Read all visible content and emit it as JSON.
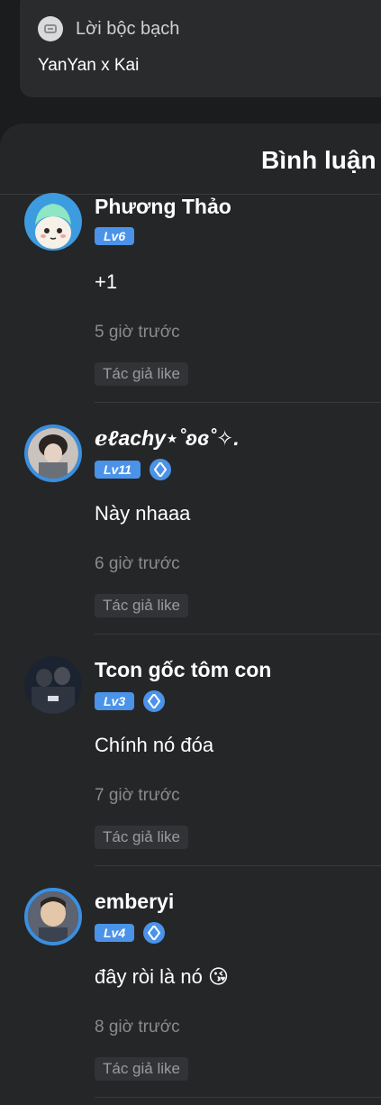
{
  "top": {
    "tag_label": "Lời bộc bạch",
    "story_title": "YanYan x Kai"
  },
  "comments_header": "Bình luận",
  "comments": [
    {
      "username": "Phương Thảo",
      "level": "Lv6",
      "text": "+1",
      "time": "5 giờ trước",
      "author_like": "Tác giả like"
    },
    {
      "username": "ℯℓachy⋆˚ʚɞ˚✧.",
      "level": "Lv11",
      "text": "Này nhaaa",
      "time": "6 giờ trước",
      "author_like": "Tác giả like"
    },
    {
      "username": "Tcon gốc tôm con",
      "level": "Lv3",
      "text": "Chính nó đóa",
      "time": "7 giờ trước",
      "author_like": "Tác giả like"
    },
    {
      "username": "emberyi",
      "level": "Lv4",
      "text": "đây ròi là nó 😘",
      "time": "8 giờ trước",
      "author_like": "Tác giả like"
    }
  ],
  "colors": {
    "level_badge": "#4a93e8",
    "background": "#1b1c1e",
    "panel": "#252628"
  }
}
